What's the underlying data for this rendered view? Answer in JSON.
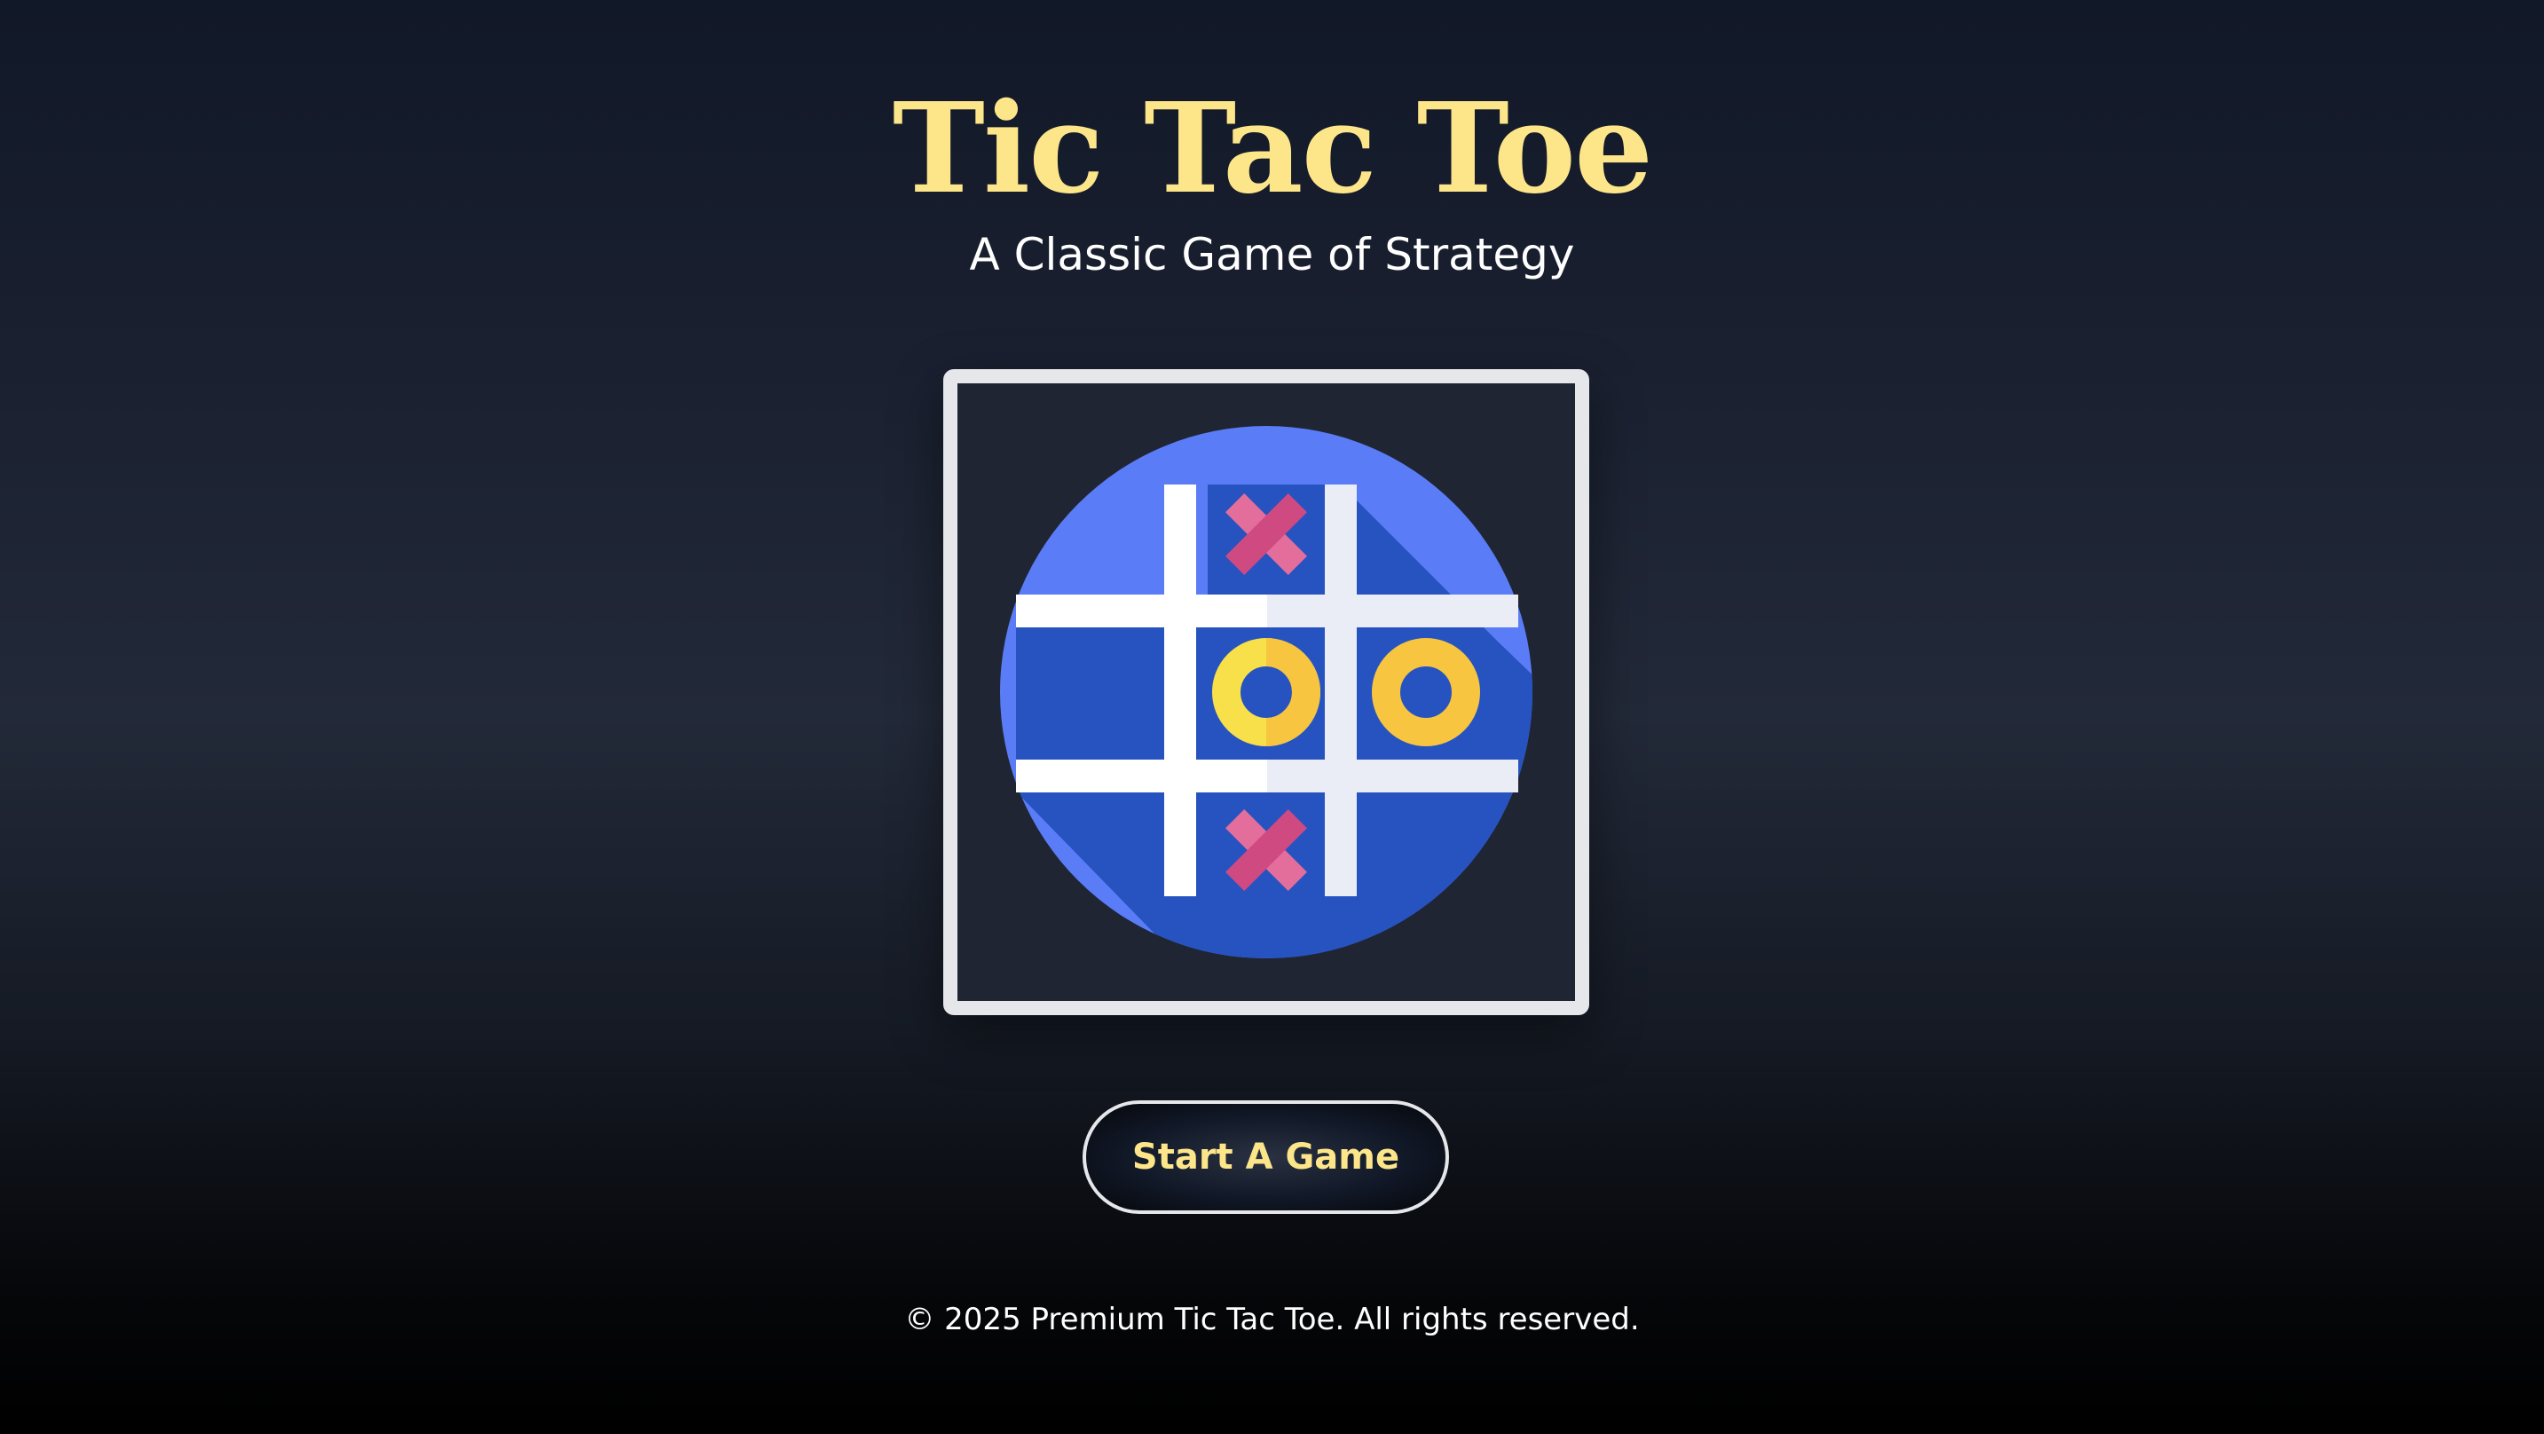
{
  "header": {
    "title": "Tic Tac Toe",
    "subtitle": "A Classic Game of Strategy"
  },
  "hero": {
    "icon": "tic-tac-toe-board-icon"
  },
  "actions": {
    "start_label": "Start A Game"
  },
  "footer": {
    "copyright": "© 2025 Premium Tic Tac Toe. All rights reserved."
  },
  "colors": {
    "accent": "#fde68a",
    "text": "#ffffff",
    "frame_border": "#e5e7eb",
    "frame_bg": "#1f2533",
    "circle_light": "#5b7cf7",
    "circle_shadow": "#2653c0",
    "grid": "#ffffff",
    "cross": "#e46e9b",
    "ring": "#f7c53f"
  }
}
